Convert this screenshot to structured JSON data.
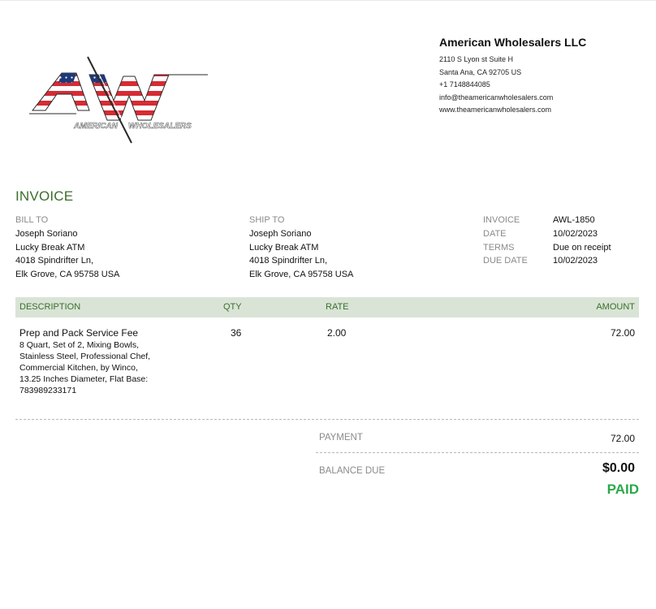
{
  "company": {
    "name": "American Wholesalers LLC",
    "address1": "2110 S Lyon st Suite H",
    "address2": "Santa Ana, CA  92705 US",
    "phone": "+1 7148844085",
    "email": "info@theamericanwholesalers.com",
    "website": "www.theamericanwholesalers.com"
  },
  "logo": {
    "letters": "AW",
    "caption_left": "AMERICAN",
    "caption_right": "WHOLESALERS",
    "colors": {
      "red": "#d62b34",
      "blue": "#1e3a78",
      "white": "#ffffff"
    }
  },
  "invoice_title": "INVOICE",
  "bill_to": {
    "label": "BILL TO",
    "lines": [
      "Joseph Soriano",
      "Lucky Break ATM",
      "4018 Spindrifter Ln,",
      "Elk Grove, CA  95758 USA"
    ]
  },
  "ship_to": {
    "label": "SHIP TO",
    "lines": [
      "Joseph Soriano",
      "Lucky Break ATM",
      "4018 Spindrifter Ln,",
      "Elk Grove, CA  95758 USA"
    ]
  },
  "meta": [
    {
      "key": "INVOICE",
      "value": "AWL-1850"
    },
    {
      "key": "DATE",
      "value": "10/02/2023"
    },
    {
      "key": "TERMS",
      "value": "Due on receipt"
    },
    {
      "key": "DUE DATE",
      "value": "10/02/2023"
    }
  ],
  "table": {
    "headers": {
      "description": "DESCRIPTION",
      "qty": "QTY",
      "rate": "RATE",
      "amount": "AMOUNT"
    },
    "items": [
      {
        "name": "Prep and Pack Service Fee",
        "description": "8 Quart, Set of 2, Mixing Bowls, Stainless Steel, Professional Chef, Commercial Kitchen, by Winco, 13.25 Inches Diameter, Flat Base: 783989233171",
        "qty": "36",
        "rate": "2.00",
        "amount": "72.00"
      }
    ]
  },
  "totals": {
    "payment_label": "PAYMENT",
    "payment_value": "72.00",
    "balance_label": "BALANCE DUE",
    "balance_value": "$0.00",
    "status": "PAID"
  },
  "colors": {
    "accent_green": "#3b6e2b",
    "header_bg": "#d9e4d6",
    "paid_green": "#2ba84a"
  }
}
